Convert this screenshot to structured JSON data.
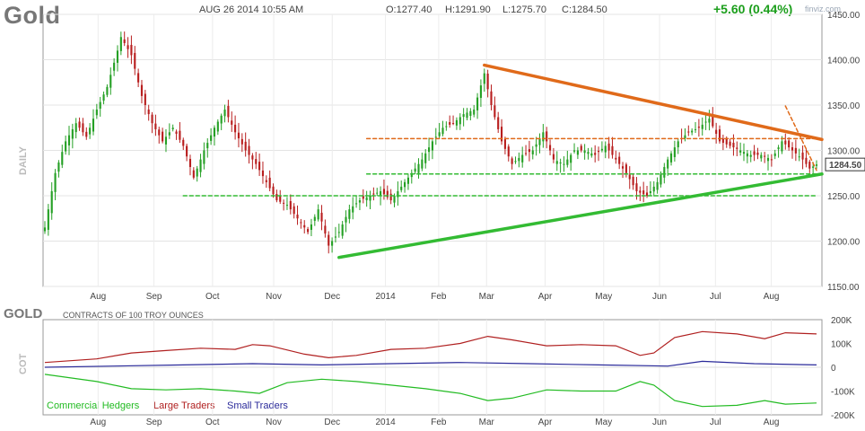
{
  "header": {
    "title": "Gold",
    "datetime": "AUG 26 2014 10:55 AM",
    "open": "O:1277.40",
    "high": "H:1291.90",
    "low": "L:1275.70",
    "close": "C:1284.50",
    "change": "+5.60 (0.44%)",
    "brand": "finviz.com",
    "side_label": "DAILY"
  },
  "cot": {
    "title": "GOLD",
    "subtitle": "CONTRACTS OF 100 TROY OUNCES",
    "side_label": "COT",
    "legend": [
      "Commercial Hedgers",
      "Large Traders",
      "Small Traders"
    ],
    "colors": {
      "commercial": "#22bb22",
      "large": "#b02020",
      "small": "#2a2a9a"
    }
  },
  "chart_data": [
    {
      "type": "candlestick",
      "x_labels": [
        "Aug",
        "Sep",
        "Oct",
        "Nov",
        "Dec",
        "2014",
        "Feb",
        "Mar",
        "Apr",
        "May",
        "Jun",
        "Jul",
        "Aug"
      ],
      "y_ticks": [
        1150,
        1200,
        1250,
        1300,
        1350,
        1400,
        1450
      ],
      "ylim": [
        1150,
        1450
      ],
      "last_price": "1284.50",
      "close_path": [
        [
          0,
          1215
        ],
        [
          3,
          1275
        ],
        [
          6,
          1310
        ],
        [
          9,
          1330
        ],
        [
          12,
          1315
        ],
        [
          15,
          1345
        ],
        [
          18,
          1370
        ],
        [
          21,
          1410
        ],
        [
          22,
          1425
        ],
        [
          25,
          1405
        ],
        [
          28,
          1360
        ],
        [
          31,
          1330
        ],
        [
          34,
          1310
        ],
        [
          37,
          1325
        ],
        [
          40,
          1305
        ],
        [
          43,
          1270
        ],
        [
          46,
          1300
        ],
        [
          49,
          1325
        ],
        [
          52,
          1345
        ],
        [
          55,
          1320
        ],
        [
          58,
          1300
        ],
        [
          61,
          1285
        ],
        [
          64,
          1265
        ],
        [
          67,
          1245
        ],
        [
          70,
          1240
        ],
        [
          73,
          1225
        ],
        [
          76,
          1210
        ],
        [
          79,
          1235
        ],
        [
          82,
          1195
        ],
        [
          85,
          1210
        ],
        [
          88,
          1235
        ],
        [
          91,
          1245
        ],
        [
          94,
          1250
        ],
        [
          97,
          1255
        ],
        [
          100,
          1245
        ],
        [
          103,
          1260
        ],
        [
          106,
          1275
        ],
        [
          109,
          1290
        ],
        [
          112,
          1310
        ],
        [
          115,
          1325
        ],
        [
          118,
          1330
        ],
        [
          121,
          1340
        ],
        [
          124,
          1345
        ],
        [
          127,
          1385
        ],
        [
          129,
          1350
        ],
        [
          132,
          1310
        ],
        [
          135,
          1285
        ],
        [
          138,
          1295
        ],
        [
          141,
          1300
        ],
        [
          144,
          1320
        ],
        [
          147,
          1290
        ],
        [
          150,
          1285
        ],
        [
          153,
          1300
        ],
        [
          156,
          1300
        ],
        [
          159,
          1295
        ],
        [
          162,
          1305
        ],
        [
          165,
          1290
        ],
        [
          168,
          1275
        ],
        [
          171,
          1255
        ],
        [
          174,
          1250
        ],
        [
          177,
          1265
        ],
        [
          180,
          1290
        ],
        [
          183,
          1310
        ],
        [
          186,
          1320
        ],
        [
          189,
          1325
        ],
        [
          192,
          1335
        ],
        [
          195,
          1310
        ],
        [
          198,
          1305
        ],
        [
          201,
          1300
        ],
        [
          204,
          1295
        ],
        [
          207,
          1295
        ],
        [
          210,
          1290
        ],
        [
          213,
          1310
        ],
        [
          216,
          1300
        ],
        [
          219,
          1290
        ],
        [
          221,
          1280
        ],
        [
          223,
          1284.5
        ]
      ],
      "n_days": 224,
      "lines": [
        {
          "name": "resistance",
          "color": "#e06a1a",
          "dash": false,
          "from": [
            127,
            1394
          ],
          "to": [
            223,
            1312
          ]
        },
        {
          "name": "support",
          "color": "#33bb33",
          "dash": false,
          "from": [
            85,
            1182
          ],
          "to": [
            223,
            1274
          ]
        },
        {
          "name": "h-resistance",
          "color": "#e06a1a",
          "dash": true,
          "from": [
            93,
            1313
          ],
          "to": [
            223,
            1313
          ]
        },
        {
          "name": "h-support-1",
          "color": "#33bb33",
          "dash": true,
          "from": [
            93,
            1274
          ],
          "to": [
            223,
            1274
          ]
        },
        {
          "name": "h-support-2",
          "color": "#33bb33",
          "dash": true,
          "from": [
            40,
            1250
          ],
          "to": [
            223,
            1250
          ]
        },
        {
          "name": "short-trend",
          "color": "#e06a1a",
          "dash": true,
          "from": [
            214,
            1349
          ],
          "to": [
            223,
            1278
          ]
        }
      ]
    },
    {
      "type": "line",
      "y_ticks": [
        "200K",
        "100K",
        "0",
        "-100K",
        "-200K"
      ],
      "ylim": [
        -200,
        200
      ],
      "series": [
        {
          "key": "large",
          "values": [
            [
              0,
              20
            ],
            [
              15,
              35
            ],
            [
              25,
              60
            ],
            [
              35,
              70
            ],
            [
              45,
              80
            ],
            [
              55,
              75
            ],
            [
              60,
              95
            ],
            [
              65,
              90
            ],
            [
              75,
              55
            ],
            [
              82,
              40
            ],
            [
              90,
              50
            ],
            [
              100,
              75
            ],
            [
              110,
              80
            ],
            [
              120,
              100
            ],
            [
              128,
              130
            ],
            [
              135,
              115
            ],
            [
              145,
              90
            ],
            [
              155,
              95
            ],
            [
              165,
              90
            ],
            [
              172,
              50
            ],
            [
              176,
              60
            ],
            [
              182,
              125
            ],
            [
              190,
              150
            ],
            [
              200,
              140
            ],
            [
              208,
              120
            ],
            [
              214,
              145
            ],
            [
              223,
              140
            ]
          ]
        },
        {
          "key": "small",
          "values": [
            [
              0,
              0
            ],
            [
              20,
              5
            ],
            [
              40,
              10
            ],
            [
              60,
              15
            ],
            [
              80,
              10
            ],
            [
              100,
              15
            ],
            [
              120,
              20
            ],
            [
              140,
              15
            ],
            [
              160,
              10
            ],
            [
              180,
              5
            ],
            [
              190,
              25
            ],
            [
              205,
              15
            ],
            [
              223,
              10
            ]
          ]
        },
        {
          "key": "commercial",
          "values": [
            [
              0,
              -30
            ],
            [
              15,
              -60
            ],
            [
              25,
              -90
            ],
            [
              35,
              -95
            ],
            [
              45,
              -90
            ],
            [
              55,
              -100
            ],
            [
              62,
              -110
            ],
            [
              70,
              -65
            ],
            [
              80,
              -50
            ],
            [
              90,
              -60
            ],
            [
              100,
              -75
            ],
            [
              110,
              -90
            ],
            [
              120,
              -110
            ],
            [
              128,
              -140
            ],
            [
              135,
              -130
            ],
            [
              145,
              -95
            ],
            [
              155,
              -100
            ],
            [
              165,
              -100
            ],
            [
              172,
              -60
            ],
            [
              176,
              -75
            ],
            [
              182,
              -140
            ],
            [
              190,
              -165
            ],
            [
              200,
              -160
            ],
            [
              208,
              -140
            ],
            [
              214,
              -155
            ],
            [
              223,
              -150
            ]
          ]
        }
      ]
    }
  ]
}
